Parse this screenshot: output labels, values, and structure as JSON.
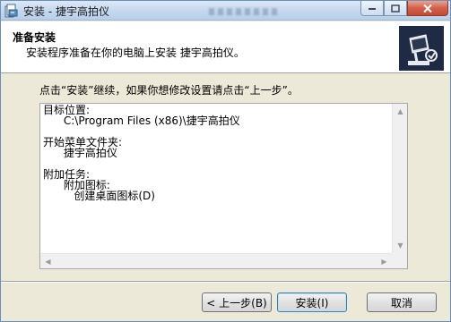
{
  "window": {
    "title": "安装 - 捷宇高拍仪"
  },
  "header": {
    "title": "准备安装",
    "subtitle": "安装程序准备在你的电脑上安装 捷宇高拍仪。"
  },
  "intro": "点击“安装”继续，如果你想修改设置请点击“上一步”。",
  "summary": {
    "lines": [
      "目标位置:",
      "      C:\\Program Files (x86)\\捷宇高拍仪",
      "",
      "开始菜单文件夹:",
      "      捷宇高拍仪",
      "",
      "附加任务:",
      "      附加图标:",
      "         创建桌面图标(D)"
    ]
  },
  "buttons": {
    "back": "< 上一步(B)",
    "install": "安装(I)",
    "cancel": "取消"
  },
  "colors": {
    "titlebar": "#c3d7ee",
    "close_button": "#d2604a",
    "logo_background": "#1f2a44",
    "default_button_border": "#3c7fb1"
  }
}
